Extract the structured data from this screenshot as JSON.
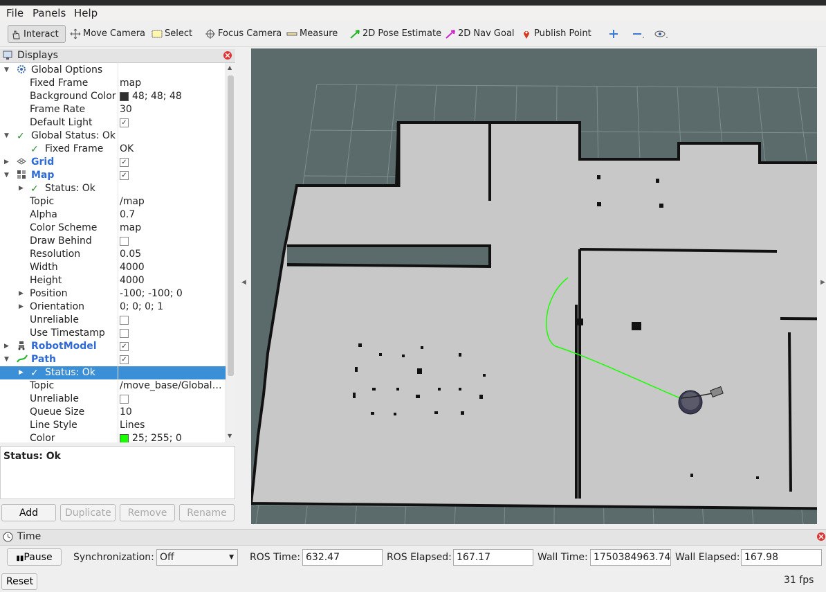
{
  "menubar": {
    "file": "File",
    "panels": "Panels",
    "help": "Help"
  },
  "toolbar": {
    "interact": "Interact",
    "move_camera": "Move Camera",
    "select": "Select",
    "focus_camera": "Focus Camera",
    "measure": "Measure",
    "pose_estimate": "2D Pose Estimate",
    "nav_goal": "2D Nav Goal",
    "publish_point": "Publish Point"
  },
  "displays": {
    "title": "Displays",
    "rows": [
      {
        "name": "Global Options",
        "value": ""
      },
      {
        "name": "Fixed Frame",
        "value": "map"
      },
      {
        "name": "Background Color",
        "value": "48; 48; 48",
        "swatch": "#303030"
      },
      {
        "name": "Frame Rate",
        "value": "30"
      },
      {
        "name": "Default Light",
        "value": "",
        "checked": true
      },
      {
        "name": "Global Status: Ok",
        "value": ""
      },
      {
        "name": "Fixed Frame",
        "value": "OK"
      },
      {
        "name": "Grid",
        "value": "",
        "checked": true
      },
      {
        "name": "Map",
        "value": "",
        "checked": true
      },
      {
        "name": "Status: Ok",
        "value": ""
      },
      {
        "name": "Topic",
        "value": "/map"
      },
      {
        "name": "Alpha",
        "value": "0.7"
      },
      {
        "name": "Color Scheme",
        "value": "map"
      },
      {
        "name": "Draw Behind",
        "value": "",
        "checked": false
      },
      {
        "name": "Resolution",
        "value": "0.05"
      },
      {
        "name": "Width",
        "value": "4000"
      },
      {
        "name": "Height",
        "value": "4000"
      },
      {
        "name": "Position",
        "value": "-100; -100; 0"
      },
      {
        "name": "Orientation",
        "value": "0; 0; 0; 1"
      },
      {
        "name": "Unreliable",
        "value": "",
        "checked": false
      },
      {
        "name": "Use Timestamp",
        "value": "",
        "checked": false
      },
      {
        "name": "RobotModel",
        "value": "",
        "checked": true
      },
      {
        "name": "Path",
        "value": "",
        "checked": true
      },
      {
        "name": "Status: Ok",
        "value": ""
      },
      {
        "name": "Topic",
        "value": "/move_base/GlobalPlanner/plan"
      },
      {
        "name": "Unreliable",
        "value": "",
        "checked": false
      },
      {
        "name": "Queue Size",
        "value": "10"
      },
      {
        "name": "Line Style",
        "value": "Lines"
      },
      {
        "name": "Color",
        "value": "25; 255; 0",
        "swatch": "#19ff00"
      }
    ],
    "status_text": "Status: Ok",
    "buttons": {
      "add": "Add",
      "duplicate": "Duplicate",
      "remove": "Remove",
      "rename": "Rename"
    }
  },
  "time": {
    "title": "Time",
    "pause": "Pause",
    "sync_label": "Synchronization:",
    "sync_value": "Off",
    "ros_time_label": "ROS Time:",
    "ros_time": "632.47",
    "ros_elapsed_label": "ROS Elapsed:",
    "ros_elapsed": "167.17",
    "wall_time_label": "Wall Time:",
    "wall_time": "1750384963.74",
    "wall_elapsed_label": "Wall Elapsed:",
    "wall_elapsed": "167.98",
    "reset": "Reset",
    "fps": "31 fps"
  },
  "colors": {
    "selection": "#3a8fd6",
    "path": "#19ff00",
    "view_bg": "#5b6b6b",
    "map_free": "#c8c8c8"
  }
}
